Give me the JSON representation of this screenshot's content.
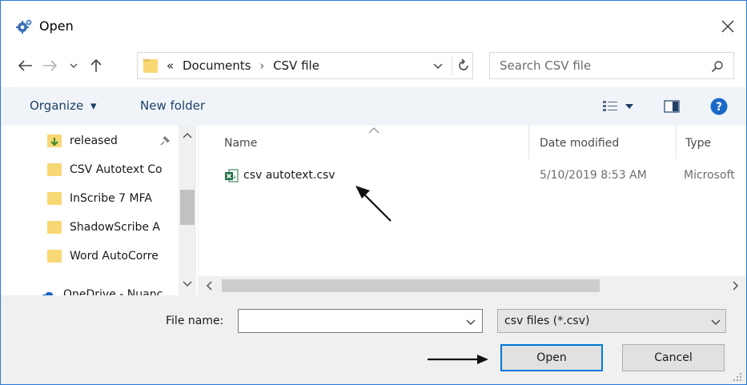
{
  "window": {
    "title": "Open",
    "icon": "gear-app-icon",
    "close_icon": "close-icon"
  },
  "nav": {
    "back_icon": "back-arrow-icon",
    "forward_icon": "forward-arrow-icon",
    "recent_icon": "chevron-down-icon",
    "up_icon": "up-arrow-icon"
  },
  "address": {
    "overflow": "«",
    "crumbs": [
      "Documents",
      "CSV file"
    ],
    "separator": "›",
    "refresh_icon": "refresh-icon"
  },
  "search": {
    "placeholder": "Search CSV file",
    "icon": "search-icon"
  },
  "toolbar": {
    "organize_label": "Organize",
    "organize_caret": "▾",
    "new_folder_label": "New folder",
    "view_icon": "view-details-icon",
    "preview_icon": "preview-pane-icon",
    "help_icon": "help-icon",
    "help_glyph": "?"
  },
  "sidebar": {
    "items": [
      {
        "label": "released",
        "pinned": true
      },
      {
        "label": "CSV Autotext Co"
      },
      {
        "label": "InScribe 7 MFA"
      },
      {
        "label": "ShadowScribe A"
      },
      {
        "label": "Word AutoCorre"
      },
      {
        "label": "OneDrive - Nuanc"
      }
    ]
  },
  "file_list": {
    "columns": [
      "Name",
      "Date modified",
      "Type"
    ],
    "rows": [
      {
        "name": "csv autotext.csv",
        "date_modified": "5/10/2019 8:53 AM",
        "type": "Microsoft"
      }
    ]
  },
  "footer": {
    "file_name_label": "File name:",
    "file_name_value": "",
    "file_type_selected": "csv files (*.csv)",
    "open_label": "Open",
    "cancel_label": "Cancel"
  },
  "colors": {
    "accent": "#0078d7",
    "folder": "#f8d775",
    "link_text": "#1e3f66",
    "excel_green": "#1f7244"
  }
}
